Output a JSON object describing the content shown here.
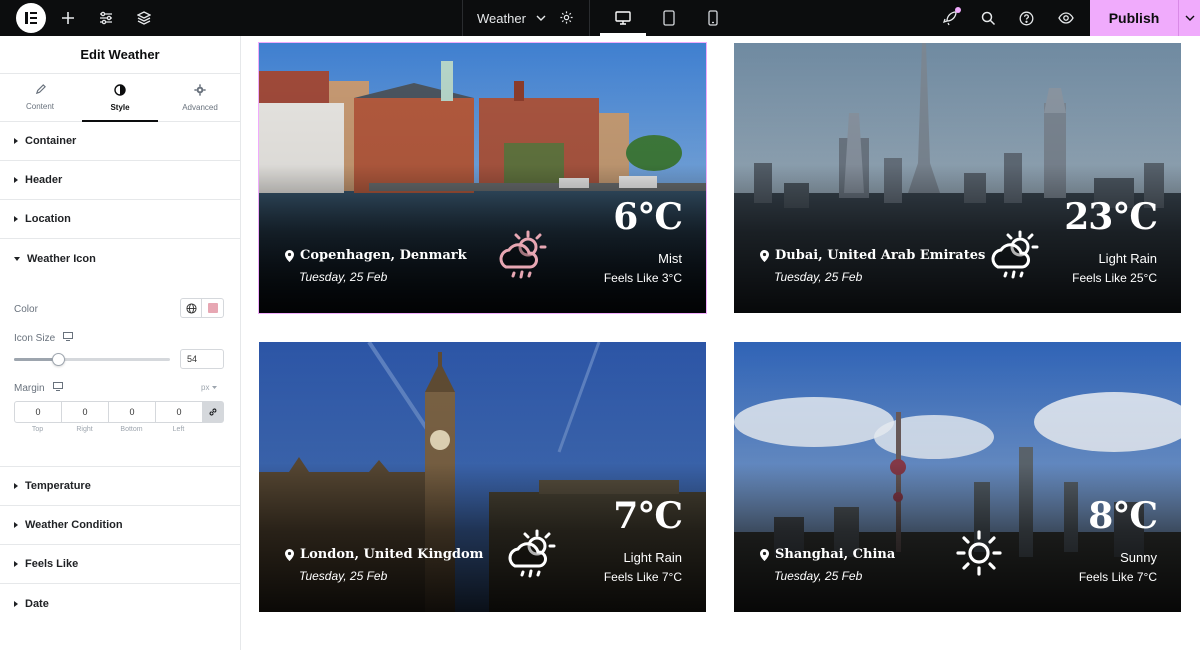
{
  "topbar": {
    "document_name": "Weather",
    "publish_label": "Publish",
    "icons": [
      "elementor-logo-icon",
      "add-icon",
      "sliders-icon",
      "layers-icon",
      "chevron-down-icon",
      "gear-icon",
      "desktop-icon",
      "tablet-icon",
      "mobile-icon",
      "rocket-icon",
      "search-icon",
      "help-icon",
      "eye-icon"
    ],
    "accent": "#f0abfc"
  },
  "panel": {
    "title": "Edit Weather",
    "tabs": [
      {
        "label": "Content",
        "icon": "pencil-icon"
      },
      {
        "label": "Style",
        "icon": "half-circle-icon",
        "active": true
      },
      {
        "label": "Advanced",
        "icon": "gear-icon"
      }
    ],
    "sections": {
      "container": "Container",
      "header": "Header",
      "location": "Location",
      "weather_icon": "Weather Icon",
      "temperature": "Temperature",
      "weather_condition": "Weather Condition",
      "feels_like": "Feels Like",
      "date": "Date"
    },
    "weather_icon_controls": {
      "color_label": "Color",
      "color_value": "#e7a7b3",
      "icon_size_label": "Icon Size",
      "icon_size_value": "54",
      "icon_size_fraction": 0.28,
      "margin_label": "Margin",
      "margin_unit": "px",
      "margin_values": [
        "0",
        "0",
        "0",
        "0"
      ],
      "margin_sides": [
        "Top",
        "Right",
        "Bottom",
        "Left"
      ]
    }
  },
  "cards": [
    {
      "location": "Copenhagen, Denmark",
      "date": "Tuesday, 25 Feb",
      "temperature": "6°C",
      "condition": "Mist",
      "feels_like": "Feels Like 3°C",
      "icon": "cloud-sun-rain-icon",
      "icon_color": "#e7a7b3"
    },
    {
      "location": "Dubai, United Arab Emirates",
      "date": "Tuesday, 25 Feb",
      "temperature": "23°C",
      "condition": "Light Rain",
      "feels_like": "Feels Like 25°C",
      "icon": "cloud-sun-rain-icon",
      "icon_color": "#ffffff"
    },
    {
      "location": "London, United Kingdom",
      "date": "Tuesday, 25 Feb",
      "temperature": "7°C",
      "condition": "Light Rain",
      "feels_like": "Feels Like 7°C",
      "icon": "cloud-sun-rain-icon",
      "icon_color": "#ffffff"
    },
    {
      "location": "Shanghai, China",
      "date": "Tuesday, 25 Feb",
      "temperature": "8°C",
      "condition": "Sunny",
      "feels_like": "Feels Like 7°C",
      "icon": "sun-icon",
      "icon_color": "#ffffff"
    }
  ]
}
